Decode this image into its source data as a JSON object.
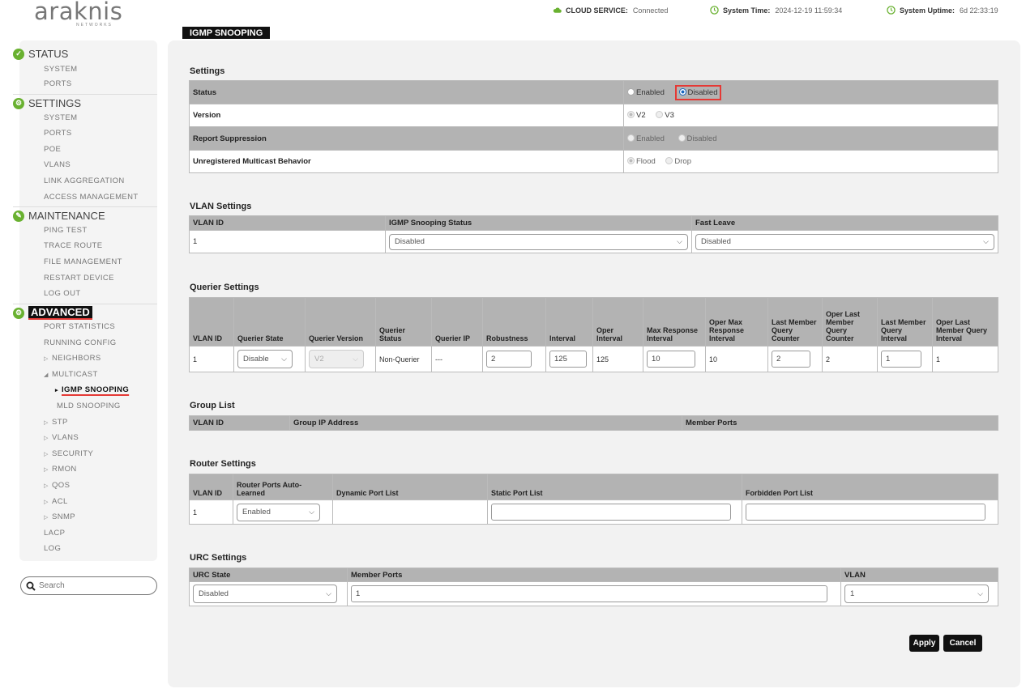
{
  "header": {
    "logo_text": "araknis",
    "logo_sub": "NETWORKS",
    "cloud_label": "CLOUD SERVICE:",
    "cloud_value": "Connected",
    "time_label": "System Time:",
    "time_value": "2024-12-19 11:59:34",
    "uptime_label": "System Uptime:",
    "uptime_value": "6d 22:33:19"
  },
  "sidebar": {
    "status": {
      "label": "STATUS",
      "items": [
        "SYSTEM",
        "PORTS"
      ]
    },
    "settings": {
      "label": "SETTINGS",
      "items": [
        "SYSTEM",
        "PORTS",
        "POE",
        "VLANS",
        "LINK AGGREGATION",
        "ACCESS MANAGEMENT"
      ]
    },
    "maintenance": {
      "label": "MAINTENANCE",
      "items": [
        "PING TEST",
        "TRACE ROUTE",
        "FILE MANAGEMENT",
        "RESTART DEVICE",
        "LOG OUT"
      ]
    },
    "advanced": {
      "label": "ADVANCED",
      "port_statistics": "PORT STATISTICS",
      "running_config": "RUNNING CONFIG",
      "neighbors": "NEIGHBORS",
      "multicast": "MULTICAST",
      "igmp_snooping": "IGMP SNOOPING",
      "mld_snooping": "MLD SNOOPING",
      "stp": "STP",
      "vlans": "VLANS",
      "security": "SECURITY",
      "rmon": "RMON",
      "qos": "QOS",
      "acl": "ACL",
      "snmp": "SNMP",
      "lacp": "LACP",
      "log": "LOG"
    },
    "search_placeholder": "Search"
  },
  "page": {
    "tab_title": "IGMP SNOOPING"
  },
  "settings": {
    "title": "Settings",
    "status_label": "Status",
    "status_enabled": "Enabled",
    "status_disabled": "Disabled",
    "version_label": "Version",
    "version_v2": "V2",
    "version_v3": "V3",
    "report_label": "Report Suppression",
    "report_enabled": "Enabled",
    "report_disabled": "Disabled",
    "unreg_label": "Unregistered Multicast Behavior",
    "unreg_flood": "Flood",
    "unreg_drop": "Drop"
  },
  "vlan_settings": {
    "title": "VLAN Settings",
    "headers": [
      "VLAN ID",
      "IGMP Snooping Status",
      "Fast Leave"
    ],
    "vlan_id": "1",
    "snooping_status": "Disabled",
    "fast_leave": "Disabled"
  },
  "querier": {
    "title": "Querier Settings",
    "headers": [
      "VLAN ID",
      "Querier State",
      "Querier Version",
      "Querier Status",
      "Querier IP",
      "Robustness",
      "Interval",
      "Oper Interval",
      "Max Response Interval",
      "Oper Max Response Interval",
      "Last Member Query Counter",
      "Oper Last Member Query Counter",
      "Last Member Query Interval",
      "Oper Last Member Query Interval"
    ],
    "vlan_id": "1",
    "state": "Disable",
    "version": "V2",
    "status": "Non-Querier",
    "ip": "---",
    "robustness": "2",
    "interval": "125",
    "oper_interval": "125",
    "max_response": "10",
    "oper_max_response": "10",
    "lmq_counter": "2",
    "oper_lmq_counter": "2",
    "lmq_interval": "1",
    "oper_lmq_interval": "1"
  },
  "group_list": {
    "title": "Group List",
    "headers": [
      "VLAN ID",
      "Group IP Address",
      "Member Ports"
    ]
  },
  "router": {
    "title": "Router Settings",
    "headers": [
      "VLAN ID",
      "Router Ports Auto-Learned",
      "Dynamic Port List",
      "Static Port List",
      "Forbidden Port List"
    ],
    "vlan_id": "1",
    "auto_learned": "Enabled"
  },
  "urc": {
    "title": "URC Settings",
    "headers": [
      "URC State",
      "Member Ports",
      "VLAN"
    ],
    "state": "Disabled",
    "member_ports": "1",
    "vlan": "1"
  },
  "buttons": {
    "apply": "Apply",
    "cancel": "Cancel"
  },
  "colors": {
    "accent_green": "#69b130",
    "highlight_red": "#e53935",
    "header_gray": "#b3b3b3"
  }
}
